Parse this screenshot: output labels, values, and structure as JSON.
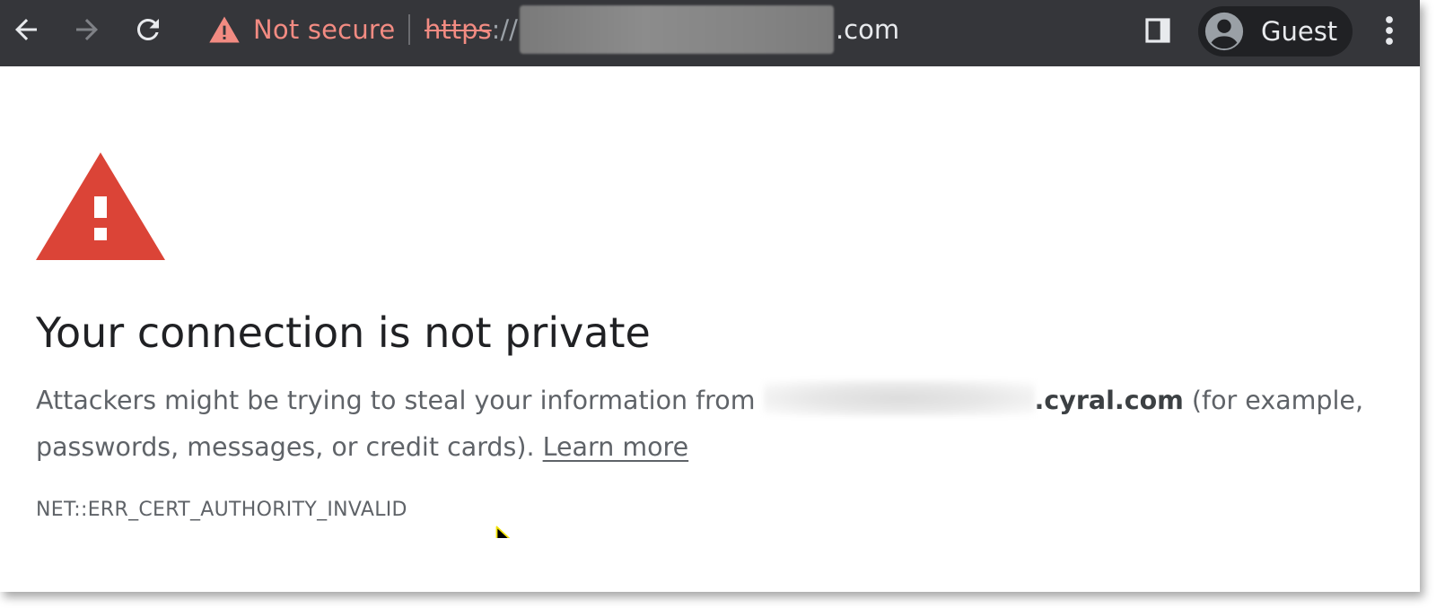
{
  "toolbar": {
    "security_label": "Not secure",
    "url_scheme": "https",
    "url_separator": "://",
    "url_domain_suffix": ".com",
    "profile_label": "Guest"
  },
  "page": {
    "heading": "Your connection is not private",
    "body_prefix": "Attackers might be trying to steal your information from ",
    "host_suffix": ".cyral.com",
    "body_middle": " (for example, passwords, messages, or credit cards). ",
    "learn_more": "Learn more",
    "error_code": "NET::ERR_CERT_AUTHORITY_INVALID"
  },
  "colors": {
    "toolbar_bg": "#35363a",
    "insecure_red": "#f28b82",
    "warning_triangle": "#db4437",
    "heading_text": "#202124",
    "body_text": "#5f6368"
  },
  "icons": {
    "back": "arrow-left-icon",
    "forward": "arrow-right-icon",
    "reload": "reload-icon",
    "security": "warning-triangle-icon",
    "split": "split-view-icon",
    "profile": "account-circle-icon",
    "menu": "kebab-menu-icon",
    "page_warning": "red-warning-triangle-icon",
    "cursor": "mouse-pointer-icon"
  }
}
